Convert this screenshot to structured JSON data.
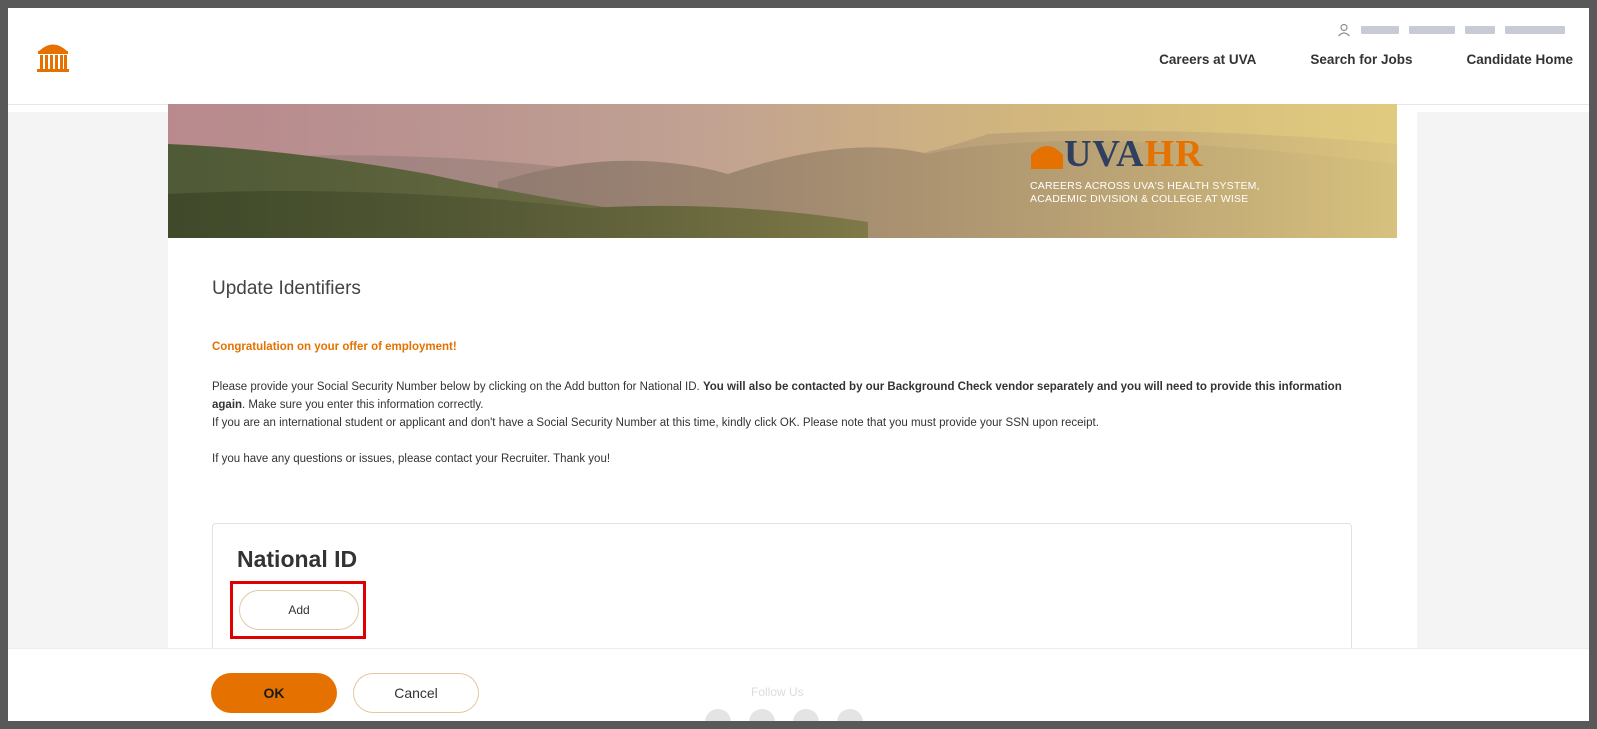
{
  "header": {
    "nav": [
      "Careers at UVA",
      "Search for Jobs",
      "Candidate Home"
    ]
  },
  "banner": {
    "logo_text_uva": "UVA",
    "logo_text_hr": "HR",
    "tagline_line1": "CAREERS ACROSS UVA'S HEALTH SYSTEM,",
    "tagline_line2": "ACADEMIC DIVISION & COLLEGE AT WISE"
  },
  "page": {
    "title": "Update Identifiers",
    "congrats": "Congratulation on your offer of employment!",
    "para1_plain": "Please provide your Social Security Number below by clicking on the Add button for National ID. ",
    "para1_bold": "You will also be contacted by our Background Check vendor separately and you will need to provide this information again",
    "para1_tail": ".  Make sure you enter this information correctly.",
    "para2": "If you are an international student or applicant and don't have a Social Security Number at this time, kindly click OK. Please note that you must provide your SSN upon receipt.",
    "para3": "If you have any questions or issues, please contact your Recruiter. Thank you!"
  },
  "national_id": {
    "title": "National ID",
    "add_label": "Add"
  },
  "footer": {
    "ok_label": "OK",
    "cancel_label": "Cancel",
    "follow_label": "Follow Us"
  },
  "colors": {
    "accent_orange": "#e57200",
    "highlight_red": "#e00000",
    "uva_navy": "#2f3f5f"
  },
  "icons": [
    "uva-rotunda-logo-icon",
    "user-icon",
    "uvahr-dome-icon"
  ]
}
